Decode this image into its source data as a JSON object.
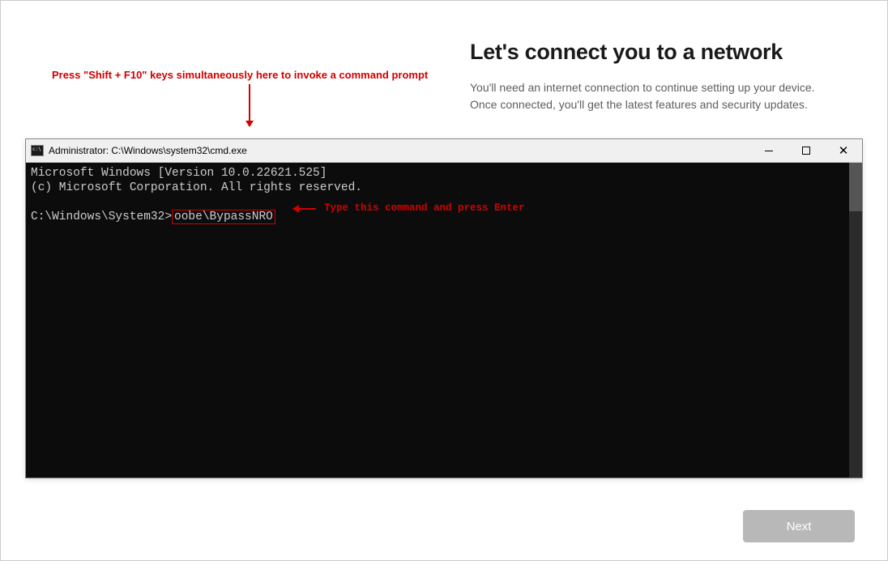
{
  "header": {
    "title": "Let's connect you to a network",
    "subtitle": "You'll need an internet connection to continue setting up your device. Once connected, you'll get the latest features and security updates."
  },
  "annotations": {
    "top": "Press \"Shift + F10\" keys simultaneously here to invoke a command prompt",
    "command": "Type this command and press Enter"
  },
  "cmd": {
    "title": "Administrator: C:\\Windows\\system32\\cmd.exe",
    "line1": "Microsoft Windows [Version 10.0.22621.525]",
    "line2": "(c) Microsoft Corporation. All rights reserved.",
    "prompt": "C:\\Windows\\System32>",
    "typed": "oobe\\BypassNRO"
  },
  "buttons": {
    "next": "Next"
  }
}
